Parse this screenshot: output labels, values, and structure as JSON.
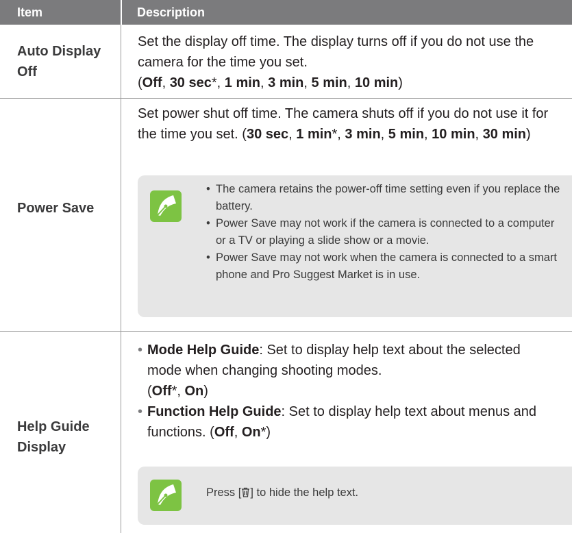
{
  "header": {
    "item": "Item",
    "description": "Description"
  },
  "rows": {
    "auto_display_off": {
      "label": "Auto Display Off",
      "text": "Set the display off time. The display turns off if you do not use the camera for the time you set.",
      "opt1": "Off",
      "opt2": "30 sec",
      "opt3": "1 min",
      "opt4": "3 min",
      "opt5": "5 min",
      "opt6": "10 min"
    },
    "power_save": {
      "label": "Power Save",
      "text": "Set power shut off time. The camera shuts off if you do not use it for the time you set.",
      "opt1": "30 sec",
      "opt2": "1 min",
      "opt3": "3 min",
      "opt4": "5 min",
      "opt5": "10 min",
      "opt6": "30 min",
      "note_items": [
        "The camera retains the power-off time setting even if you replace the battery.",
        "Power Save may not work if the camera is connected to a computer or a TV or playing a slide show or a movie.",
        "Power Save may not work when the camera is connected to a smart phone and Pro Suggest Market is in use."
      ]
    },
    "help_guide_display": {
      "label": "Help Guide Display",
      "mode_title": "Mode Help Guide",
      "mode_text": ": Set to display help text about the selected mode when changing shooting modes.",
      "function_title": "Function Help Guide",
      "function_text": ": Set to display help text about menus and functions.",
      "off": "Off",
      "on": "On",
      "note_before": "Press [",
      "note_after": "] to hide the help text."
    }
  },
  "colors": {
    "header_bg": "#7b7b7d",
    "note_bg": "#e6e6e6",
    "note_icon": "#7dc343"
  }
}
